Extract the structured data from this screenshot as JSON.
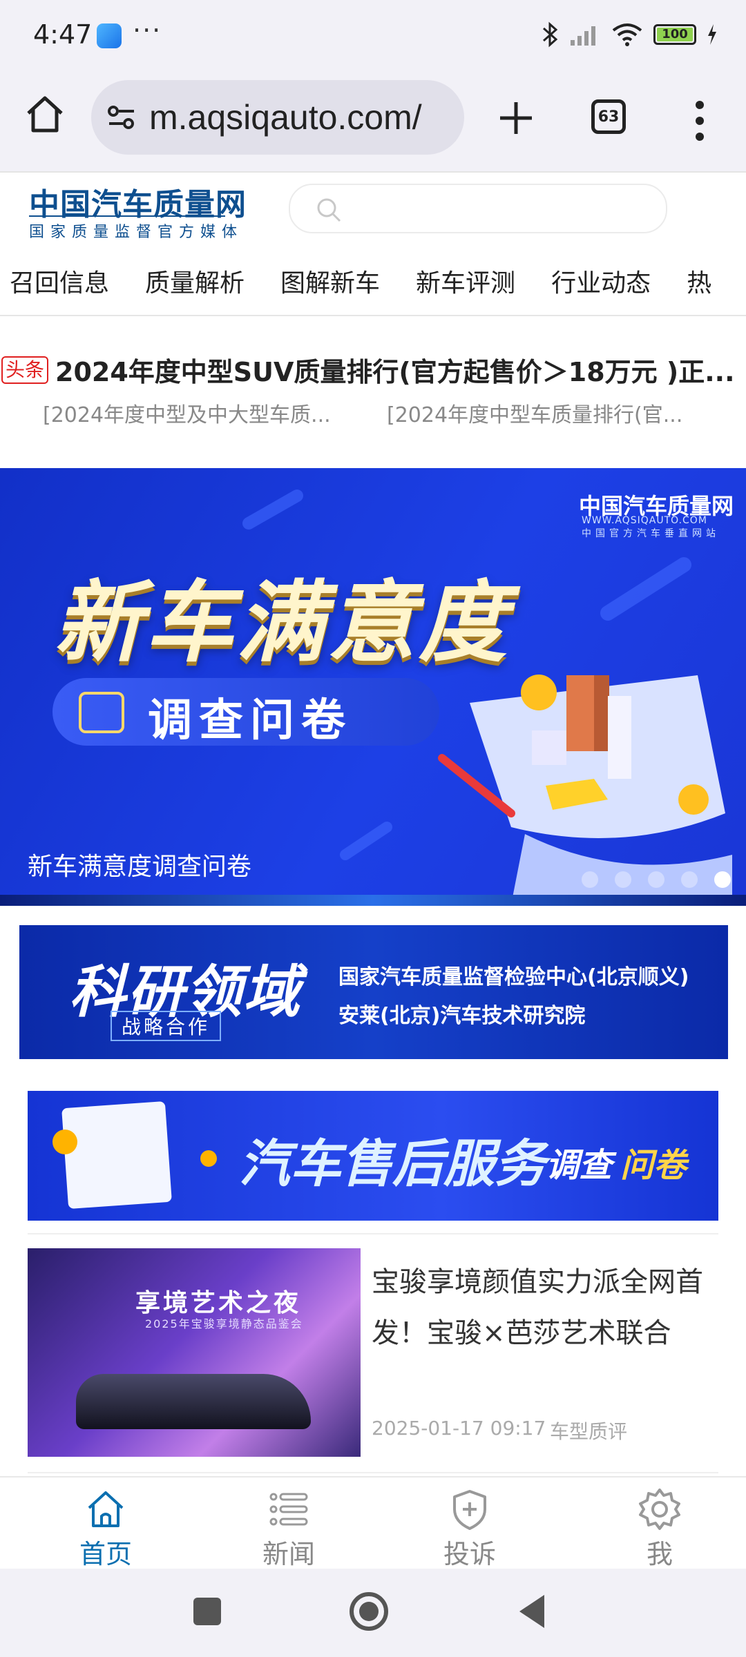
{
  "status_bar": {
    "time": "4:47",
    "dots": "···",
    "battery": "100"
  },
  "browser": {
    "url": "m.aqsiqauto.com/",
    "tab_count": "63"
  },
  "site": {
    "logo_title": "中国汽车质量网",
    "logo_subtitle": "国家质量监督官方媒体",
    "search_placeholder": ""
  },
  "categories": [
    "召回信息",
    "质量解析",
    "图解新车",
    "新车评测",
    "行业动态",
    "热"
  ],
  "headline": {
    "tag": "头条",
    "title": "2024年度中型SUV质量排行(官方起售价＞18万元 )正...",
    "sub_links": [
      "[2024年度中型及中大型车质...",
      "[2024年度中型车质量排行(官..."
    ]
  },
  "carousel": {
    "brand": "中国汽车质量网",
    "brand_url": "WWW.AQSIQAUTO.COM",
    "brand_sub": "中国官方汽车垂直网站",
    "headline": "新车满意度",
    "pill_text": "调查问卷",
    "caption": "新车满意度调查问卷",
    "slide_count": 5,
    "active_slide": 5
  },
  "ad1": {
    "title": "科研领域",
    "badge": "战略合作",
    "line1": "国家汽车质量监督检验中心(北京顺义)",
    "line2": "安莱(北京)汽车技术研究院"
  },
  "ad2": {
    "title": "汽车售后服务",
    "sub1": "调查",
    "sub2": "问卷"
  },
  "news": [
    {
      "image_title": "享境艺术之夜",
      "image_sub": "2025年宝骏享境静态品鉴会",
      "title": "宝骏享境颜值实力派全网首发！宝骏×芭莎艺术联合举...",
      "date": "2025-01-17 09:17",
      "category": "车型质评"
    }
  ],
  "tabbar": [
    {
      "label": "首页",
      "icon": "home-icon",
      "active": true
    },
    {
      "label": "新闻",
      "icon": "list-icon",
      "active": false
    },
    {
      "label": "投诉",
      "icon": "shield-plus-icon",
      "active": false
    },
    {
      "label": "我",
      "icon": "gear-icon",
      "active": false
    }
  ],
  "colors": {
    "brand_blue": "#0e4f8f",
    "tab_active": "#0b6fb0",
    "headline_tag": "#e02020",
    "banner_blue": "#1d40e6"
  }
}
